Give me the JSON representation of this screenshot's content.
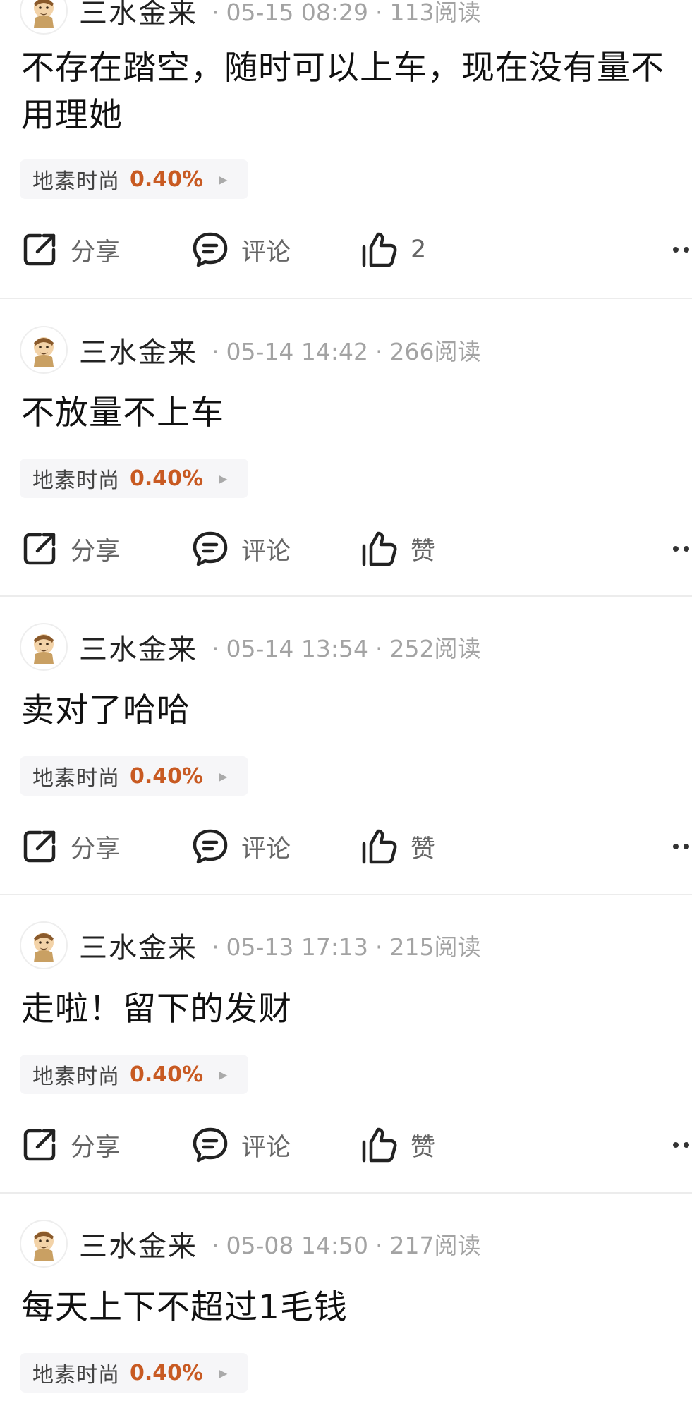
{
  "posts": [
    {
      "author": "三水金来",
      "date": "05-15 08:29",
      "reads": "113阅读",
      "content_lines": [
        "不存在踏空，随时可以上车，现在没有量不",
        "用理她"
      ],
      "tag": {
        "name": "地素时尚",
        "value": "0.40%"
      },
      "share_label": "分享",
      "comment_label": "评论",
      "like_label": "2"
    },
    {
      "author": "三水金来",
      "date": "05-14 14:42",
      "reads": "266阅读",
      "content_lines": [
        "不放量不上车"
      ],
      "tag": {
        "name": "地素时尚",
        "value": "0.40%"
      },
      "share_label": "分享",
      "comment_label": "评论",
      "like_label": "赞"
    },
    {
      "author": "三水金来",
      "date": "05-14 13:54",
      "reads": "252阅读",
      "content_lines": [
        "卖对了哈哈"
      ],
      "tag": {
        "name": "地素时尚",
        "value": "0.40%"
      },
      "share_label": "分享",
      "comment_label": "评论",
      "like_label": "赞"
    },
    {
      "author": "三水金来",
      "date": "05-13 17:13",
      "reads": "215阅读",
      "content_lines": [
        "走啦！留下的发财"
      ],
      "tag": {
        "name": "地素时尚",
        "value": "0.40%"
      },
      "share_label": "分享",
      "comment_label": "评论",
      "like_label": "赞"
    },
    {
      "author": "三水金来",
      "date": "05-08 14:50",
      "reads": "217阅读",
      "content_lines": [
        "每天上下不超过1毛钱"
      ],
      "tag": {
        "name": "地素时尚",
        "value": "0.40%"
      },
      "share_label": "",
      "comment_label": "",
      "like_label": ""
    }
  ],
  "colors": {
    "tag_value": "#c85a22",
    "meta_gray": "#a3a3a3",
    "divider": "#ececec",
    "tag_bg": "#f6f6f8"
  },
  "icons": [
    "avatar-icon",
    "share-icon",
    "comment-icon",
    "thumbs-up-icon",
    "more-icon",
    "triangle-right-icon"
  ]
}
